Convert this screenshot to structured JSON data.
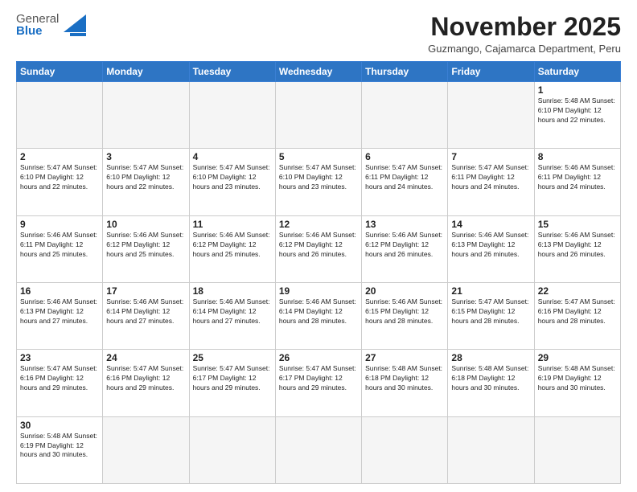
{
  "header": {
    "logo": {
      "line1": "General",
      "line2": "Blue"
    },
    "title": "November 2025",
    "subtitle": "Guzmango, Cajamarca Department, Peru"
  },
  "days_of_week": [
    "Sunday",
    "Monday",
    "Tuesday",
    "Wednesday",
    "Thursday",
    "Friday",
    "Saturday"
  ],
  "weeks": [
    [
      {
        "day": "",
        "info": ""
      },
      {
        "day": "",
        "info": ""
      },
      {
        "day": "",
        "info": ""
      },
      {
        "day": "",
        "info": ""
      },
      {
        "day": "",
        "info": ""
      },
      {
        "day": "",
        "info": ""
      },
      {
        "day": "1",
        "info": "Sunrise: 5:48 AM\nSunset: 6:10 PM\nDaylight: 12 hours\nand 22 minutes."
      }
    ],
    [
      {
        "day": "2",
        "info": "Sunrise: 5:47 AM\nSunset: 6:10 PM\nDaylight: 12 hours\nand 22 minutes."
      },
      {
        "day": "3",
        "info": "Sunrise: 5:47 AM\nSunset: 6:10 PM\nDaylight: 12 hours\nand 22 minutes."
      },
      {
        "day": "4",
        "info": "Sunrise: 5:47 AM\nSunset: 6:10 PM\nDaylight: 12 hours\nand 23 minutes."
      },
      {
        "day": "5",
        "info": "Sunrise: 5:47 AM\nSunset: 6:10 PM\nDaylight: 12 hours\nand 23 minutes."
      },
      {
        "day": "6",
        "info": "Sunrise: 5:47 AM\nSunset: 6:11 PM\nDaylight: 12 hours\nand 24 minutes."
      },
      {
        "day": "7",
        "info": "Sunrise: 5:47 AM\nSunset: 6:11 PM\nDaylight: 12 hours\nand 24 minutes."
      },
      {
        "day": "8",
        "info": "Sunrise: 5:46 AM\nSunset: 6:11 PM\nDaylight: 12 hours\nand 24 minutes."
      }
    ],
    [
      {
        "day": "9",
        "info": "Sunrise: 5:46 AM\nSunset: 6:11 PM\nDaylight: 12 hours\nand 25 minutes."
      },
      {
        "day": "10",
        "info": "Sunrise: 5:46 AM\nSunset: 6:12 PM\nDaylight: 12 hours\nand 25 minutes."
      },
      {
        "day": "11",
        "info": "Sunrise: 5:46 AM\nSunset: 6:12 PM\nDaylight: 12 hours\nand 25 minutes."
      },
      {
        "day": "12",
        "info": "Sunrise: 5:46 AM\nSunset: 6:12 PM\nDaylight: 12 hours\nand 26 minutes."
      },
      {
        "day": "13",
        "info": "Sunrise: 5:46 AM\nSunset: 6:12 PM\nDaylight: 12 hours\nand 26 minutes."
      },
      {
        "day": "14",
        "info": "Sunrise: 5:46 AM\nSunset: 6:13 PM\nDaylight: 12 hours\nand 26 minutes."
      },
      {
        "day": "15",
        "info": "Sunrise: 5:46 AM\nSunset: 6:13 PM\nDaylight: 12 hours\nand 26 minutes."
      }
    ],
    [
      {
        "day": "16",
        "info": "Sunrise: 5:46 AM\nSunset: 6:13 PM\nDaylight: 12 hours\nand 27 minutes."
      },
      {
        "day": "17",
        "info": "Sunrise: 5:46 AM\nSunset: 6:14 PM\nDaylight: 12 hours\nand 27 minutes."
      },
      {
        "day": "18",
        "info": "Sunrise: 5:46 AM\nSunset: 6:14 PM\nDaylight: 12 hours\nand 27 minutes."
      },
      {
        "day": "19",
        "info": "Sunrise: 5:46 AM\nSunset: 6:14 PM\nDaylight: 12 hours\nand 28 minutes."
      },
      {
        "day": "20",
        "info": "Sunrise: 5:46 AM\nSunset: 6:15 PM\nDaylight: 12 hours\nand 28 minutes."
      },
      {
        "day": "21",
        "info": "Sunrise: 5:47 AM\nSunset: 6:15 PM\nDaylight: 12 hours\nand 28 minutes."
      },
      {
        "day": "22",
        "info": "Sunrise: 5:47 AM\nSunset: 6:16 PM\nDaylight: 12 hours\nand 28 minutes."
      }
    ],
    [
      {
        "day": "23",
        "info": "Sunrise: 5:47 AM\nSunset: 6:16 PM\nDaylight: 12 hours\nand 29 minutes."
      },
      {
        "day": "24",
        "info": "Sunrise: 5:47 AM\nSunset: 6:16 PM\nDaylight: 12 hours\nand 29 minutes."
      },
      {
        "day": "25",
        "info": "Sunrise: 5:47 AM\nSunset: 6:17 PM\nDaylight: 12 hours\nand 29 minutes."
      },
      {
        "day": "26",
        "info": "Sunrise: 5:47 AM\nSunset: 6:17 PM\nDaylight: 12 hours\nand 29 minutes."
      },
      {
        "day": "27",
        "info": "Sunrise: 5:48 AM\nSunset: 6:18 PM\nDaylight: 12 hours\nand 30 minutes."
      },
      {
        "day": "28",
        "info": "Sunrise: 5:48 AM\nSunset: 6:18 PM\nDaylight: 12 hours\nand 30 minutes."
      },
      {
        "day": "29",
        "info": "Sunrise: 5:48 AM\nSunset: 6:19 PM\nDaylight: 12 hours\nand 30 minutes."
      }
    ],
    [
      {
        "day": "30",
        "info": "Sunrise: 5:48 AM\nSunset: 6:19 PM\nDaylight: 12 hours\nand 30 minutes."
      },
      {
        "day": "",
        "info": ""
      },
      {
        "day": "",
        "info": ""
      },
      {
        "day": "",
        "info": ""
      },
      {
        "day": "",
        "info": ""
      },
      {
        "day": "",
        "info": ""
      },
      {
        "day": "",
        "info": ""
      }
    ]
  ]
}
